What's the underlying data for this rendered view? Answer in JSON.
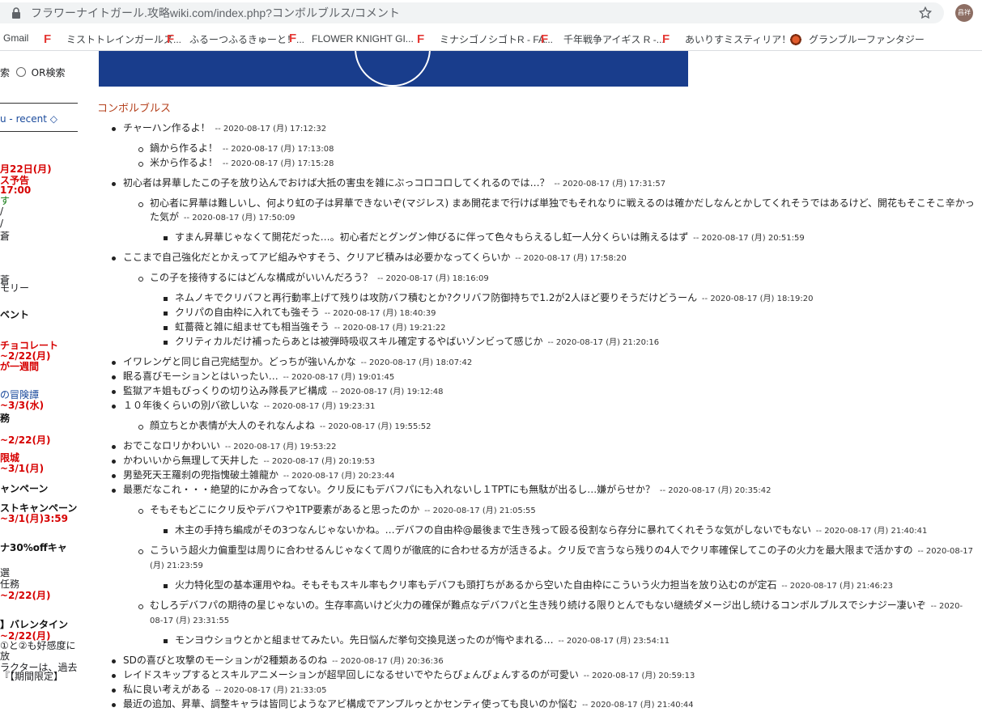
{
  "browser": {
    "url": "フラワーナイトガール.攻略wiki.com/index.php?コンボルブルス/コメント",
    "avatar_text": "昌祥",
    "bookmarks": [
      {
        "label": "Gmail",
        "icon": "gmail-icon"
      },
      {
        "label": "ミストトレインガールズ...",
        "icon": "f-favicon"
      },
      {
        "label": "ふるーつふるきゅーと！...",
        "icon": "f-favicon"
      },
      {
        "label": "FLOWER KNIGHT GI...",
        "icon": "f-favicon"
      },
      {
        "label": "ミナシゴノシゴトR - FA...",
        "icon": "f-favicon"
      },
      {
        "label": "千年戦争アイギス R -...",
        "icon": "f-favicon"
      },
      {
        "label": "あいりすミスティリア！...",
        "icon": "f-favicon"
      },
      {
        "label": "グランブルーファンタジー",
        "icon": "granblue-icon"
      }
    ]
  },
  "sidebar": {
    "search_frag": "索",
    "or_search": "OR検索",
    "menu_link": "u - recent ◇",
    "lines": [
      {
        "text": "月22日(月)",
        "style": "red"
      },
      {
        "text": "ス予告",
        "style": "red"
      },
      {
        "text": "17:00",
        "style": "red"
      },
      {
        "text": "す",
        "style": "green"
      },
      {
        "text": "/",
        "style": "plain"
      },
      {
        "text": "/",
        "style": "plain"
      },
      {
        "text": "蒼",
        "style": "plain"
      },
      {
        "text": "",
        "style": "plain"
      },
      {
        "text": "蒼",
        "style": "plain"
      },
      {
        "text": "モリー",
        "style": "plain"
      },
      {
        "text": "ベント",
        "style": "bold"
      },
      {
        "text": "チョコレート",
        "style": "red"
      },
      {
        "text": "~2/22(月)",
        "style": "red"
      },
      {
        "text": "が一週間",
        "style": "red"
      },
      {
        "text": "の冒険譚",
        "style": "blue"
      },
      {
        "text": "~3/3(水)",
        "style": "red"
      },
      {
        "text": "務",
        "style": "bold"
      },
      {
        "text": "~2/22(月)",
        "style": "red"
      },
      {
        "text": "限城",
        "style": "red"
      },
      {
        "text": "~3/1(月)",
        "style": "red"
      },
      {
        "text": "ャンペーン",
        "style": "bold"
      },
      {
        "text": "ストキャンペーン",
        "style": "bold"
      },
      {
        "text": "~3/1(月)3:59",
        "style": "red"
      },
      {
        "text": "ナ30%offキャ",
        "style": "bold"
      },
      {
        "text": "選",
        "style": "plain"
      },
      {
        "text": "任務",
        "style": "plain"
      },
      {
        "text": "~2/22(月)",
        "style": "red"
      },
      {
        "text": "】バレンタイン",
        "style": "bold"
      },
      {
        "text": "~2/22(月)",
        "style": "red"
      },
      {
        "text": "①と②も好感度に",
        "style": "plain"
      },
      {
        "text": "放",
        "style": "plain"
      },
      {
        "text": "ラクターは、過去",
        "style": "plain"
      },
      {
        "text": "『【期間限定】",
        "style": "plain"
      }
    ]
  },
  "page": {
    "title": "コンボルブルス"
  },
  "comments": [
    {
      "level": 1,
      "text": "チャーハン作るよ！",
      "date": "-- 2020-08-17 (月) 17:12:32"
    },
    {
      "gap": true
    },
    {
      "level": 2,
      "text": "鍋から作るよ！",
      "date": "-- 2020-08-17 (月) 17:13:08"
    },
    {
      "level": 2,
      "text": "米から作るよ！",
      "date": "-- 2020-08-17 (月) 17:15:28"
    },
    {
      "gap": true
    },
    {
      "level": 1,
      "text": "初心者は昇華したこの子を放り込んでおけば大抵の害虫を雑にぶっコロコロしてくれるのでは…？",
      "date": "-- 2020-08-17 (月) 17:31:57"
    },
    {
      "gap": true
    },
    {
      "level": 2,
      "text": "初心者に昇華は難しいし、何より虹の子は昇華できないぞ(マジレス) まあ開花まで行けば単独でもそれなりに戦えるのは確かだしなんとかしてくれそうではあるけど、開花もそこそこ辛かった気が",
      "date": "-- 2020-08-17 (月) 17:50:09"
    },
    {
      "gap": true
    },
    {
      "level": 3,
      "text": "すまん昇華じゃなくて開花だった…。初心者だとグングン伸びるに伴って色々もらえるし虹一人分くらいは賄えるはず",
      "date": "-- 2020-08-17 (月) 20:51:59"
    },
    {
      "gap": true
    },
    {
      "level": 1,
      "text": "ここまで自己強化だとかえってアビ組みやすそう、クリアビ積みは必要かなってくらいか",
      "date": "-- 2020-08-17 (月) 17:58:20"
    },
    {
      "gap": true
    },
    {
      "level": 2,
      "text": "この子を接待するにはどんな構成がいいんだろう？",
      "date": "-- 2020-08-17 (月) 18:16:09"
    },
    {
      "gap": true
    },
    {
      "level": 3,
      "text": "ネムノキでクリバフと再行動率上げて残りは攻防バフ積むとか?クリバフ防御持ちで1.2が2人ほど要りそうだけどうーん",
      "date": "-- 2020-08-17 (月) 18:19:20"
    },
    {
      "level": 3,
      "text": "クリパの自由枠に入れても強そう",
      "date": "-- 2020-08-17 (月) 18:40:39"
    },
    {
      "level": 3,
      "text": "虹薔薇と雑に組ませても相当強そう",
      "date": "-- 2020-08-17 (月) 19:21:22"
    },
    {
      "level": 3,
      "text": "クリティカルだけ補ったらあとは被弾時吸収スキル確定するやばいゾンビって感じか",
      "date": "-- 2020-08-17 (月) 21:20:16"
    },
    {
      "gap": true
    },
    {
      "level": 1,
      "text": "イワレンゲと同じ自己完結型か。どっちが強いんかな",
      "date": "-- 2020-08-17 (月) 18:07:42"
    },
    {
      "level": 1,
      "text": "眠る喜びモーションとはいったい…",
      "date": "-- 2020-08-17 (月) 19:01:45"
    },
    {
      "level": 1,
      "text": "監獄アキ姐もびっくりの切り込み隊長アビ構成",
      "date": "-- 2020-08-17 (月) 19:12:48"
    },
    {
      "level": 1,
      "text": "１０年後くらいの別バ欲しいな",
      "date": "-- 2020-08-17 (月) 19:23:31"
    },
    {
      "gap": true
    },
    {
      "level": 2,
      "text": "顔立ちとか表情が大人のそれなんよね",
      "date": "-- 2020-08-17 (月) 19:55:52"
    },
    {
      "gap": true
    },
    {
      "level": 1,
      "text": "おでこなロリかわいい",
      "date": "-- 2020-08-17 (月) 19:53:22"
    },
    {
      "level": 1,
      "text": "かわいいから無理して天井した",
      "date": "-- 2020-08-17 (月) 20:19:53"
    },
    {
      "level": 1,
      "text": "男塾死天王羅刹の兜指愧破土雑龍か",
      "date": "-- 2020-08-17 (月) 20:23:44"
    },
    {
      "level": 1,
      "text": "最悪だなこれ・・・絶望的にかみ合ってない。クリ反にもデバフパにも入れないし１TPTにも無駄が出るし…嫌がらせか？",
      "date": "-- 2020-08-17 (月) 20:35:42"
    },
    {
      "gap": true
    },
    {
      "level": 2,
      "text": "そもそもどこにクリ反やデバフや1TP要素があると思ったのか",
      "date": "-- 2020-08-17 (月) 21:05:55"
    },
    {
      "gap": true
    },
    {
      "level": 3,
      "text": "木主の手持ち編成がその3つなんじゃないかね。…デバフの自由枠@最後まで生き残って殴る役割なら存分に暴れてくれそうな気がしないでもない",
      "date": "-- 2020-08-17 (月) 21:40:41"
    },
    {
      "gap": true
    },
    {
      "level": 2,
      "text": "こういう超火力偏重型は周りに合わせるんじゃなくて周りが徹底的に合わせる方が活きるよ。クリ反で言うなら残りの4人でクリ率確保してこの子の火力を最大限まで活かすの",
      "date": "-- 2020-08-17 (月) 21:23:59"
    },
    {
      "gap": true
    },
    {
      "level": 3,
      "text": "火力特化型の基本運用やね。そもそもスキル率もクリ率もデバフも頭打ちがあるから空いた自由枠にこういう火力担当を放り込むのが定石",
      "date": "-- 2020-08-17 (月) 21:46:23"
    },
    {
      "gap": true
    },
    {
      "level": 2,
      "text": "むしろデバフパの期待の星じゃないの。生存率高いけど火力の確保が難点なデバフパと生き残り続ける限りとんでもない継続ダメージ出し続けるコンボルブルスでシナジー凄いぞ",
      "date": "-- 2020-08-17 (月) 23:31:55"
    },
    {
      "gap": true
    },
    {
      "level": 3,
      "text": "モンヨウショウとかと組ませてみたい。先日悩んだ挙句交換見送ったのが悔やまれる…",
      "date": "-- 2020-08-17 (月) 23:54:11"
    },
    {
      "gap": true
    },
    {
      "level": 1,
      "text": "SDの喜びと攻撃のモーションが2種類あるのね",
      "date": "-- 2020-08-17 (月) 20:36:36"
    },
    {
      "level": 1,
      "text": "レイドスキップするとスキルアニメーションが超早回しになるせいでやたらぴょんぴょんするのが可愛い",
      "date": "-- 2020-08-17 (月) 20:59:13"
    },
    {
      "level": 1,
      "text": "私に良い考えがある",
      "date": "-- 2020-08-17 (月) 21:33:05"
    },
    {
      "level": 1,
      "text": "最近の追加、昇華、調整キャラは皆同じようなアビ構成でアンプルゥとかセンティ使っても良いのか悩む",
      "date": "-- 2020-08-17 (月) 21:40:44"
    }
  ]
}
